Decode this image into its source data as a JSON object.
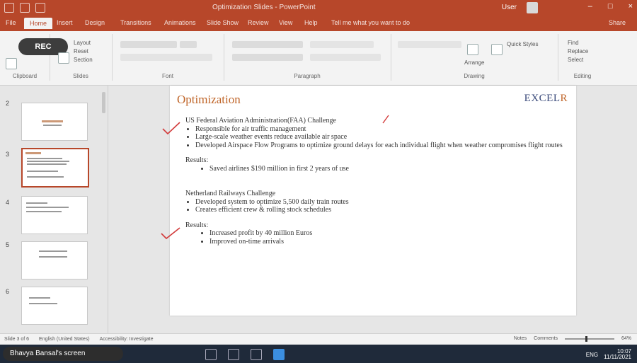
{
  "titlebar": {
    "doc_title": "Optimization Slides - PowerPoint",
    "user": "User",
    "controls": [
      "–",
      "□",
      "×"
    ]
  },
  "tabs": [
    "File",
    "Home",
    "Insert",
    "Design",
    "Transitions",
    "Animations",
    "Slide Show",
    "Review",
    "View",
    "Help",
    "Tell me what you want to do",
    "Share"
  ],
  "active_tab": "Home",
  "ribbon": {
    "rec_pill": "REC",
    "groups": [
      "Clipboard",
      "Slides",
      "Font",
      "Paragraph",
      "Drawing",
      "Editing"
    ],
    "slides_buttons": [
      "Layout",
      "Reset",
      "Section"
    ],
    "editing_buttons": [
      "Find",
      "Replace",
      "Select"
    ],
    "drawing_buttons": [
      "Arrange",
      "Quick Styles"
    ]
  },
  "thumbnails": [
    {
      "num": "2",
      "selected": false
    },
    {
      "num": "3",
      "selected": true
    },
    {
      "num": "4",
      "selected": false
    },
    {
      "num": "5",
      "selected": false
    },
    {
      "num": "6",
      "selected": false
    }
  ],
  "slide": {
    "title": "Optimization",
    "logo_main": "EXCEL",
    "logo_accent": "R",
    "section1_heading": "US Federal Aviation Administration(FAA) Challenge",
    "section1_bullets": [
      "Responsible for air traffic management",
      "Large-scale weather events reduce available air space",
      "Developed Airspace Flow Programs to optimize ground delays for each individual flight when weather compromises flight routes"
    ],
    "results1_label": "Results:",
    "results1_bullets": [
      "Saved airlines $190 million in first 2 years of use"
    ],
    "section2_heading": "Netherland Railways Challenge",
    "section2_bullets": [
      "Developed system to optimize 5,500 daily train routes",
      "Creates efficient crew & rolling stock schedules"
    ],
    "results2_label": "Results:",
    "results2_bullets": [
      "Increased profit by 40 million Euros",
      "Improved on-time arrivals"
    ]
  },
  "statusbar": {
    "slide_info": "Slide 3 of 6",
    "language": "English (United States)",
    "accessibility": "Accessibility: Investigate",
    "notes": "Notes",
    "comments": "Comments",
    "zoom": "64%"
  },
  "taskbar": {
    "share_text": "Bhavya Bansal's screen",
    "tray_text": "ENG",
    "time": "10:07",
    "date": "11/11/2021"
  },
  "colors": {
    "accent": "#b7472a",
    "title": "#c0662a",
    "logo": "#3a4a7a",
    "checkmark": "#d23a3a"
  }
}
